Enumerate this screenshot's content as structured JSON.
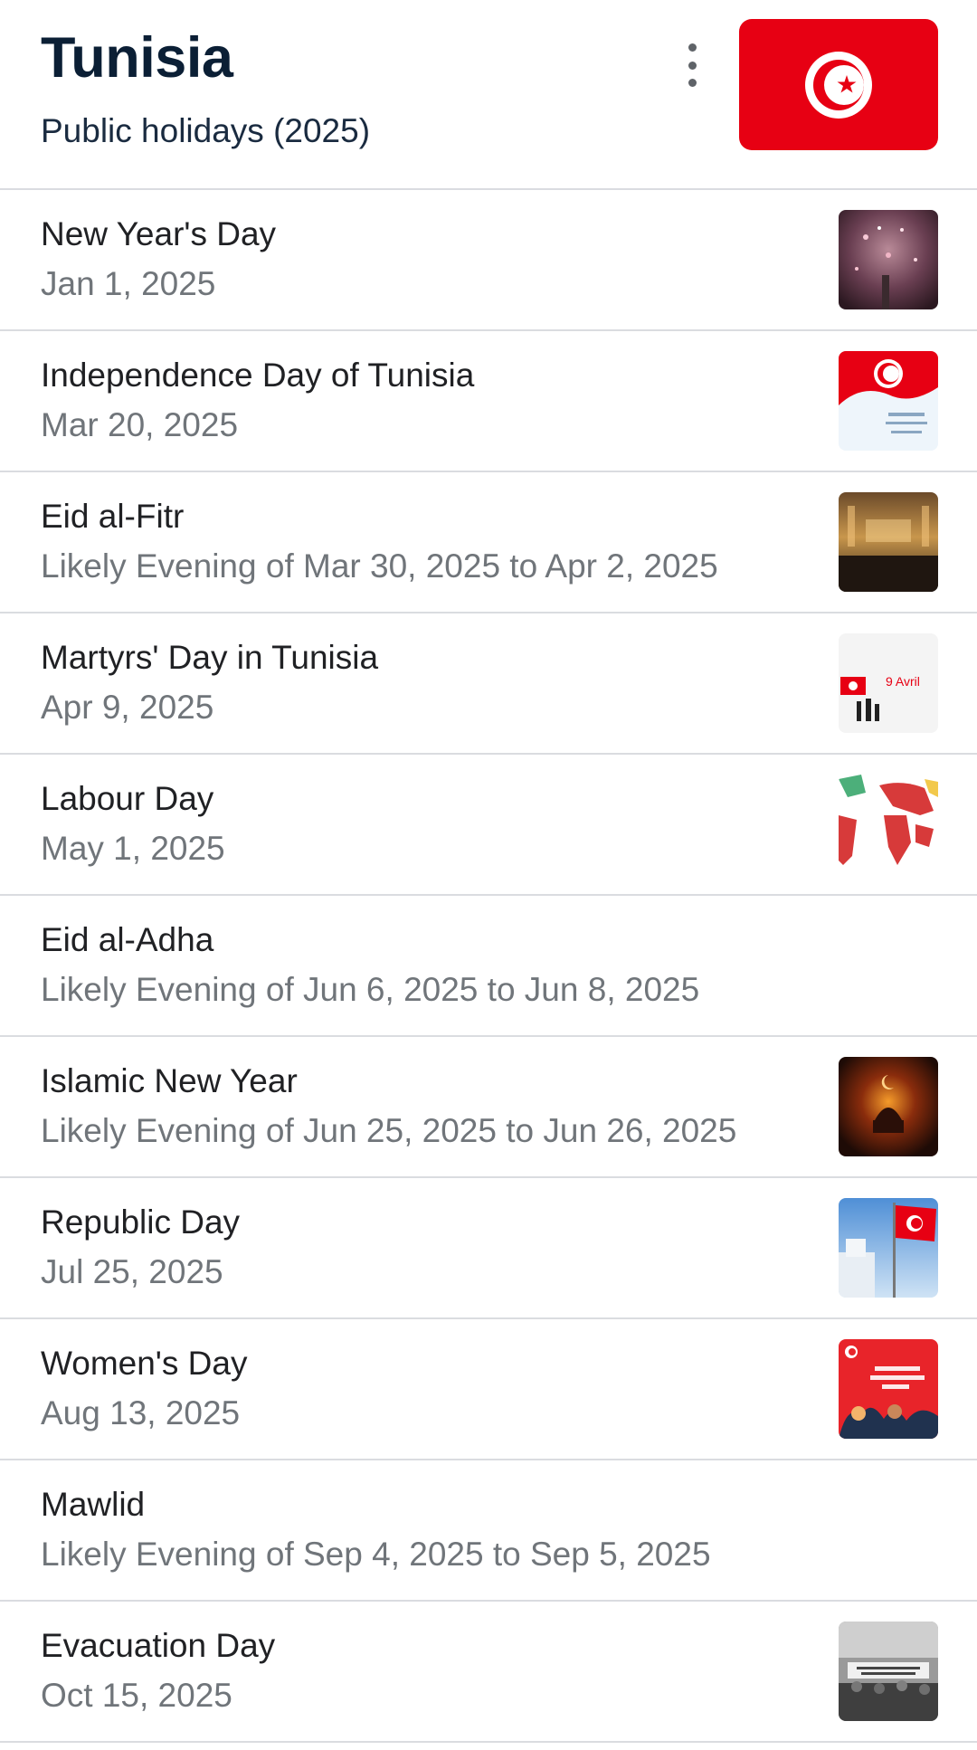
{
  "header": {
    "title": "Tunisia",
    "subtitle": "Public holidays (2025)",
    "menu_icon": "more-vert-icon",
    "flag_icon": "tunisia-flag-icon"
  },
  "colors": {
    "flag_red": "#e70013",
    "divider": "#dadce0",
    "title": "#0b1f35",
    "date_text": "#70757a"
  },
  "holidays": [
    {
      "name": "New Year's Day",
      "date": "Jan 1, 2025",
      "thumbnail": "fireworks-image"
    },
    {
      "name": "Independence Day of Tunisia",
      "date": "Mar 20, 2025",
      "thumbnail": "tunisia-flag-card-image"
    },
    {
      "name": "Eid al-Fitr",
      "date": "Likely Evening of Mar 30, 2025 to Apr 2, 2025",
      "thumbnail": "mosque-crowd-image"
    },
    {
      "name": "Martyrs' Day in Tunisia",
      "date": "Apr 9, 2025",
      "thumbnail": "martyrs-day-card-image",
      "thumbnail_text": "9 Avril"
    },
    {
      "name": "Labour Day",
      "date": "May 1, 2025",
      "thumbnail": "world-map-image"
    },
    {
      "name": "Eid al-Adha",
      "date": "Likely Evening of Jun 6, 2025 to Jun 8, 2025",
      "thumbnail": null
    },
    {
      "name": "Islamic New Year",
      "date": "Likely Evening of Jun 25, 2025 to Jun 26, 2025",
      "thumbnail": "crescent-mosque-image"
    },
    {
      "name": "Republic Day",
      "date": "Jul 25, 2025",
      "thumbnail": "flag-on-pole-image"
    },
    {
      "name": "Women's Day",
      "date": "Aug 13, 2025",
      "thumbnail": "womens-day-poster-image"
    },
    {
      "name": "Mawlid",
      "date": "Likely Evening of Sep 4, 2025 to Sep 5, 2025",
      "thumbnail": null
    },
    {
      "name": "Evacuation Day",
      "date": "Oct 15, 2025",
      "thumbnail": "historic-photo-image"
    }
  ]
}
